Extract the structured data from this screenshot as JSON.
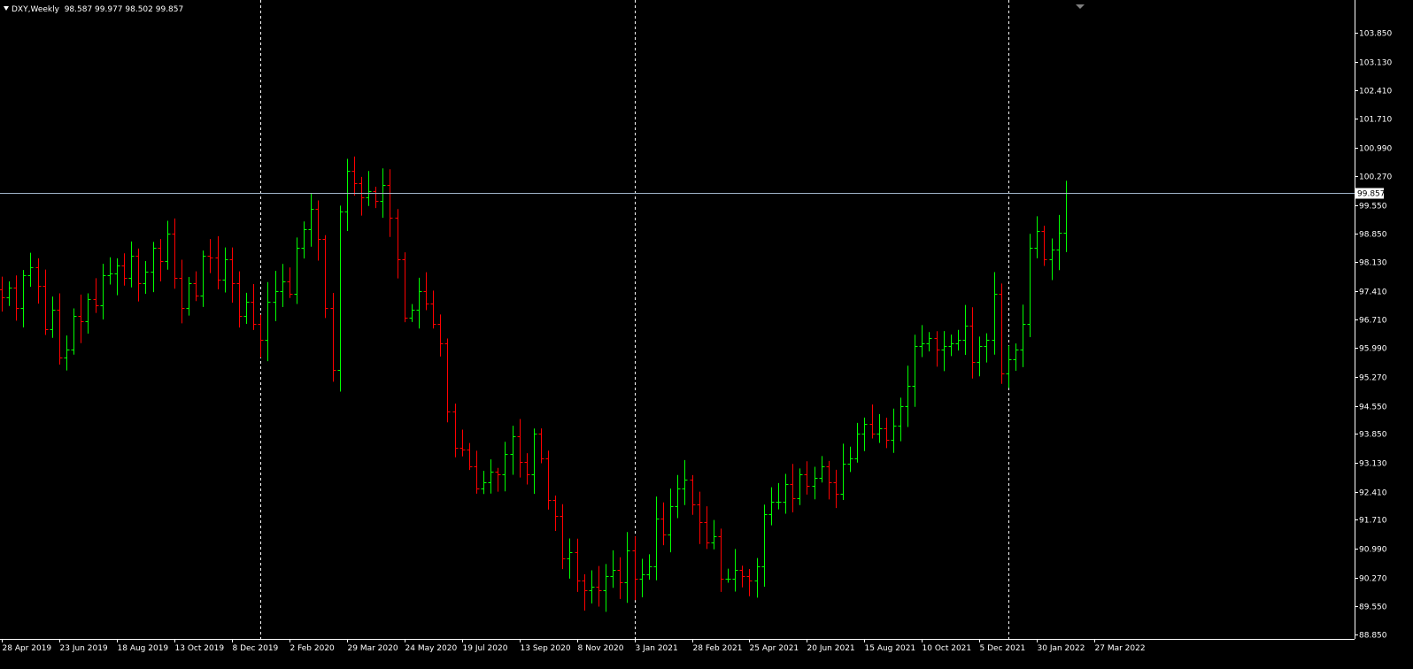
{
  "header": {
    "symbol": "DXY,Weekly",
    "ohlc": "98.587 99.977 98.502 99.857"
  },
  "colors": {
    "background": "#000000",
    "bull": "#00ff00",
    "bear": "#ff0000",
    "grid": "#ffffff",
    "price_line": "#a0b4c8",
    "text": "#ffffff",
    "price_tag_bg": "#ffffff",
    "price_tag_text": "#000000"
  },
  "chart_data": {
    "type": "ohlc",
    "instrument": "DXY",
    "timeframe": "Weekly",
    "ylim": [
      88.85,
      104.5
    ],
    "current_price": 99.857,
    "current_price_label": "99.857",
    "y_ticks": [
      "103.850",
      "103.130",
      "102.410",
      "101.710",
      "100.990",
      "100.270",
      "99.550",
      "98.850",
      "98.130",
      "97.410",
      "96.710",
      "95.990",
      "95.270",
      "94.550",
      "93.850",
      "93.130",
      "92.410",
      "91.710",
      "90.990",
      "90.270",
      "89.550",
      "88.850"
    ],
    "x_labels": [
      {
        "label": "28 Apr 2019",
        "week": 0
      },
      {
        "label": "23 Jun 2019",
        "week": 8
      },
      {
        "label": "18 Aug 2019",
        "week": 16
      },
      {
        "label": "13 Oct 2019",
        "week": 24
      },
      {
        "label": "8 Dec 2019",
        "week": 32
      },
      {
        "label": "2 Feb 2020",
        "week": 40
      },
      {
        "label": "29 Mar 2020",
        "week": 48
      },
      {
        "label": "24 May 2020",
        "week": 56
      },
      {
        "label": "19 Jul 2020",
        "week": 64
      },
      {
        "label": "13 Sep 2020",
        "week": 72
      },
      {
        "label": "8 Nov 2020",
        "week": 80
      },
      {
        "label": "3 Jan 2021",
        "week": 88
      },
      {
        "label": "28 Feb 2021",
        "week": 96
      },
      {
        "label": "25 Apr 2021",
        "week": 104
      },
      {
        "label": "20 Jun 2021",
        "week": 112
      },
      {
        "label": "15 Aug 2021",
        "week": 120
      },
      {
        "label": "10 Oct 2021",
        "week": 128
      },
      {
        "label": "5 Dec 2021",
        "week": 136
      },
      {
        "label": "30 Jan 2022",
        "week": 144
      },
      {
        "label": "27 Mar 2022",
        "week": 152
      }
    ],
    "grid_weeks": [
      36,
      88,
      140,
      192
    ],
    "close_path": [
      97.25,
      97.5,
      97.0,
      97.8,
      98.0,
      97.55,
      96.45,
      96.95,
      95.75,
      95.95,
      96.8,
      96.65,
      97.2,
      97.05,
      97.8,
      97.85,
      98.05,
      97.75,
      98.3,
      97.6,
      97.9,
      98.5,
      98.15,
      98.85,
      97.75,
      97.0,
      97.6,
      97.3,
      98.3,
      98.25,
      97.7,
      98.2,
      97.6,
      96.8,
      97.15,
      96.6,
      96.2,
      97.15,
      97.4,
      97.65,
      97.35,
      98.5,
      98.95,
      99.45,
      98.7,
      97.0,
      95.45,
      99.4,
      100.4,
      100.1,
      99.75,
      99.9,
      99.65,
      100.05,
      99.25,
      98.2,
      96.75,
      96.95,
      97.4,
      97.1,
      96.6,
      96.1,
      94.4,
      93.5,
      93.45,
      93.05,
      92.5,
      92.65,
      92.9,
      92.85,
      93.35,
      93.8,
      93.15,
      92.85,
      93.85,
      93.25,
      92.2,
      91.8,
      90.75,
      90.9,
      90.2,
      89.95,
      90.05,
      89.95,
      90.3,
      90.45,
      90.15,
      90.95,
      90.25,
      90.35,
      90.55,
      91.75,
      91.35,
      92.05,
      92.5,
      92.7,
      92.1,
      91.65,
      91.15,
      91.3,
      90.25,
      90.25,
      90.45,
      90.3,
      90.2,
      90.55,
      91.85,
      92.15,
      92.15,
      92.6,
      92.25,
      92.85,
      92.55,
      92.75,
      93.05,
      92.65,
      92.35,
      93.1,
      93.25,
      93.85,
      94.1,
      93.85,
      94.0,
      93.7,
      94.05,
      94.55,
      95.05,
      96.05,
      96.1,
      96.25,
      95.95,
      96.05,
      96.1,
      96.2,
      96.55,
      95.65,
      96.05,
      96.2,
      97.35,
      95.35,
      95.7,
      95.95,
      96.6,
      98.5,
      98.9,
      98.2,
      98.45,
      98.87,
      99.857
    ]
  }
}
